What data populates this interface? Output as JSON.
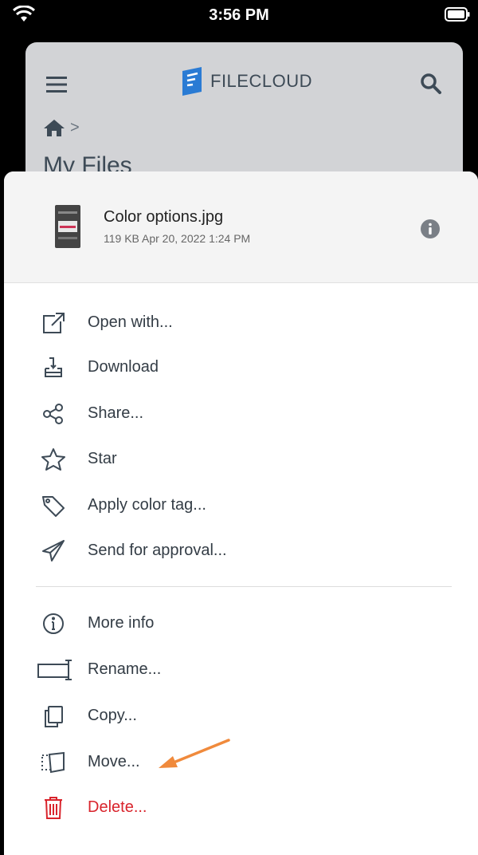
{
  "status_bar": {
    "time": "3:56 PM"
  },
  "app": {
    "logo_text": "FILECLOUD",
    "page_title": "My Files",
    "breadcrumb_separator": ">"
  },
  "file": {
    "name": "Color options.jpg",
    "meta": "119 KB Apr 20, 2022 1:24 PM"
  },
  "menu": {
    "group1": [
      {
        "label": "Open with...",
        "icon": "open-external-icon"
      },
      {
        "label": "Download",
        "icon": "download-icon"
      },
      {
        "label": "Share...",
        "icon": "share-icon"
      },
      {
        "label": "Star",
        "icon": "star-icon"
      },
      {
        "label": "Apply color tag...",
        "icon": "tag-icon"
      },
      {
        "label": "Send for approval...",
        "icon": "send-icon"
      }
    ],
    "group2": [
      {
        "label": "More info",
        "icon": "info-icon"
      },
      {
        "label": "Rename...",
        "icon": "rename-icon"
      },
      {
        "label": "Copy...",
        "icon": "copy-icon"
      },
      {
        "label": "Move...",
        "icon": "move-icon"
      },
      {
        "label": "Delete...",
        "icon": "trash-icon"
      }
    ]
  },
  "colors": {
    "accent_arrow": "#f08a3c",
    "danger": "#d9242c",
    "text": "#333c45",
    "logo_blue": "#2a7bd4"
  }
}
